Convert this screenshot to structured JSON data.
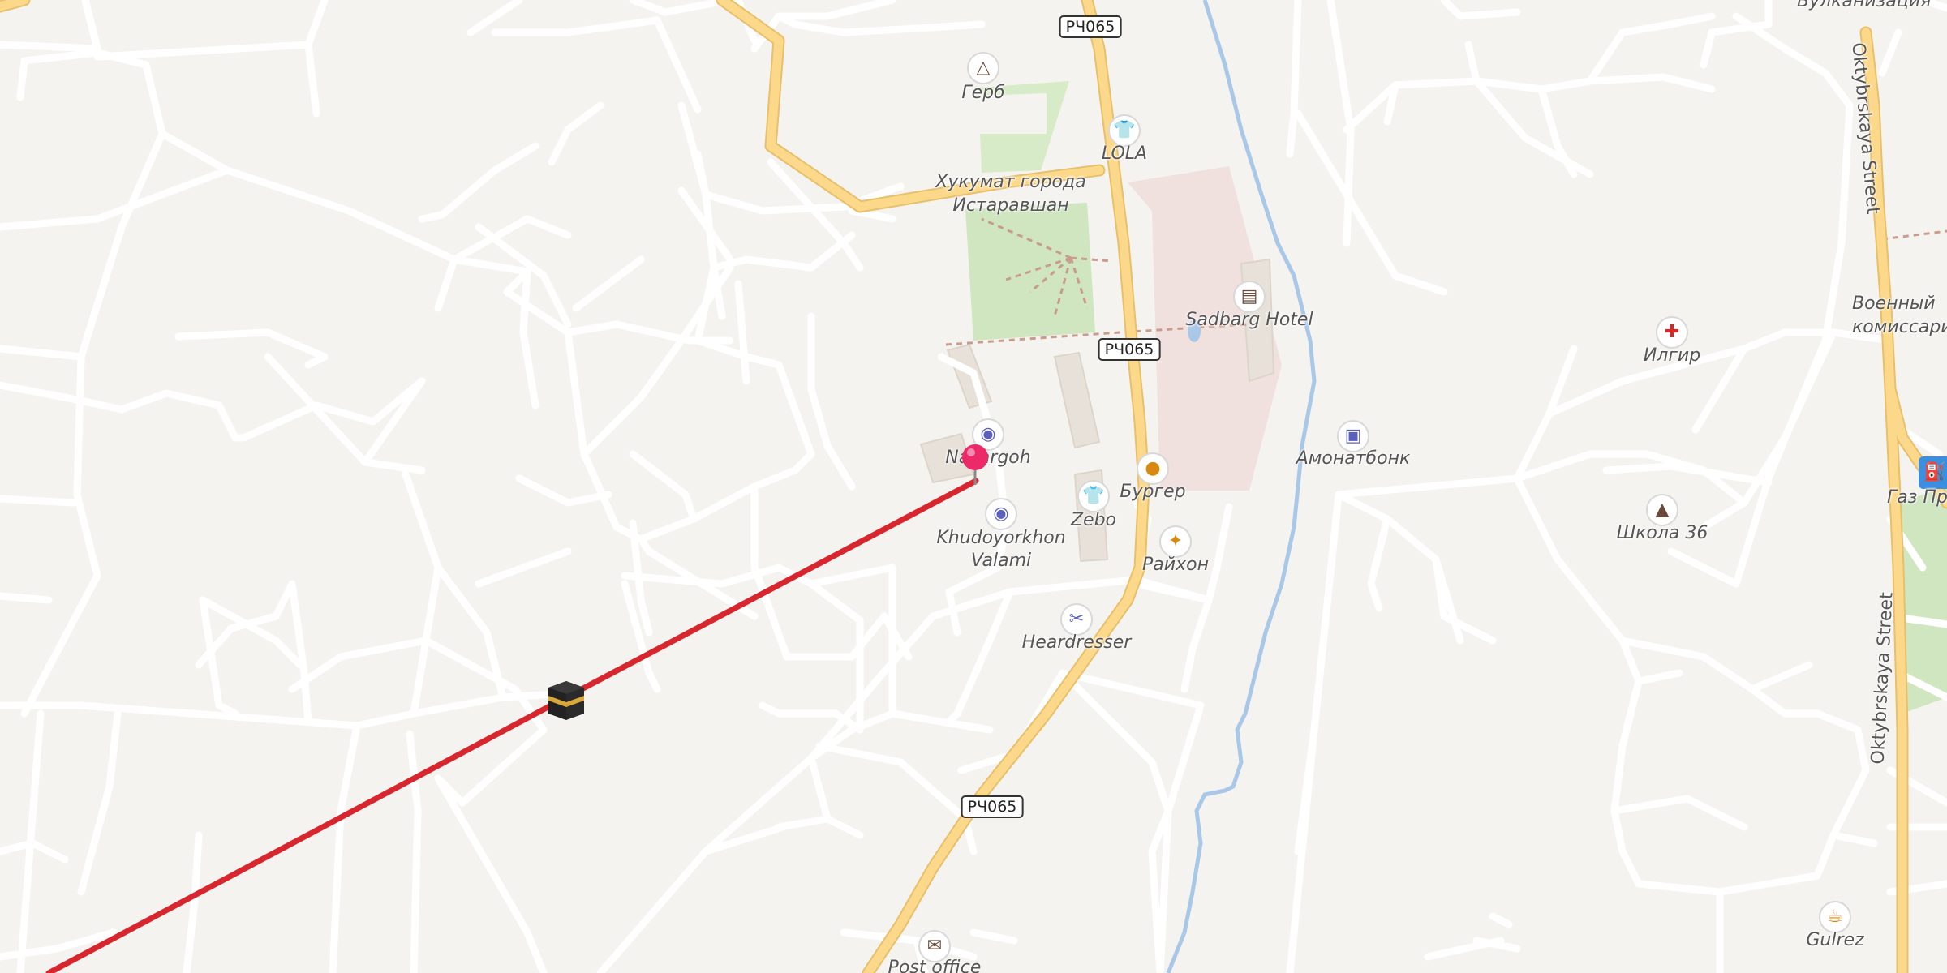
{
  "route_badge": "РЧ065",
  "roads": {
    "street_left": "Oktybrskaya Street",
    "street_right": "Oktybrskaya Street"
  },
  "places": {
    "gerb": "Герб",
    "lola": "LOLA",
    "hukumat_line1": "Хукумат города",
    "hukumat_line2": "Истаравшан",
    "sadbarg": "Sadbarg Hotel",
    "nazargoh": "Nazargoh",
    "khudoyorkhon_line1": "Khudoyorkhon",
    "khudoyorkhon_line2": "Valami",
    "zebo": "Zebo",
    "burger": "Бургер",
    "raihon": "Райхон",
    "heardresser": "Heardresser",
    "amonatbonk": "Амонатбонк",
    "ilgir": "Илгир",
    "voenny_line1": "Военный",
    "voenny_line2": "комиссари",
    "shkola": "Школа 36",
    "gaz": "Газ Про",
    "vulkanizacia": "Вулканизация",
    "post_office": "Post office",
    "gulrez": "Gulrez"
  },
  "icons": {
    "gerb": "monument-icon",
    "lola": "clothes-icon",
    "sadbarg": "hotel-icon",
    "nazargoh": "camera-icon",
    "khudoyorkhon": "camera-icon",
    "zebo": "clothes-icon",
    "burger": "burger-icon",
    "raihon": "restaurant-icon",
    "heardresser": "scissors-icon",
    "amonatbonk": "bank-icon",
    "ilgir": "pharmacy-icon",
    "shkola": "school-icon",
    "gaz": "fuel-icon",
    "post_office": "mail-icon",
    "gulrez": "cafe-icon",
    "destination": "kaaba-icon",
    "location": "location-pin-icon"
  },
  "colors": {
    "background": "#f5f3f0",
    "minor_road": "#ffffff",
    "major_road": "#fcd98a",
    "river": "#a9c8e8",
    "park": "#cfe6c1",
    "route_line": "#d8262e",
    "pin": "#ec2a6a"
  }
}
